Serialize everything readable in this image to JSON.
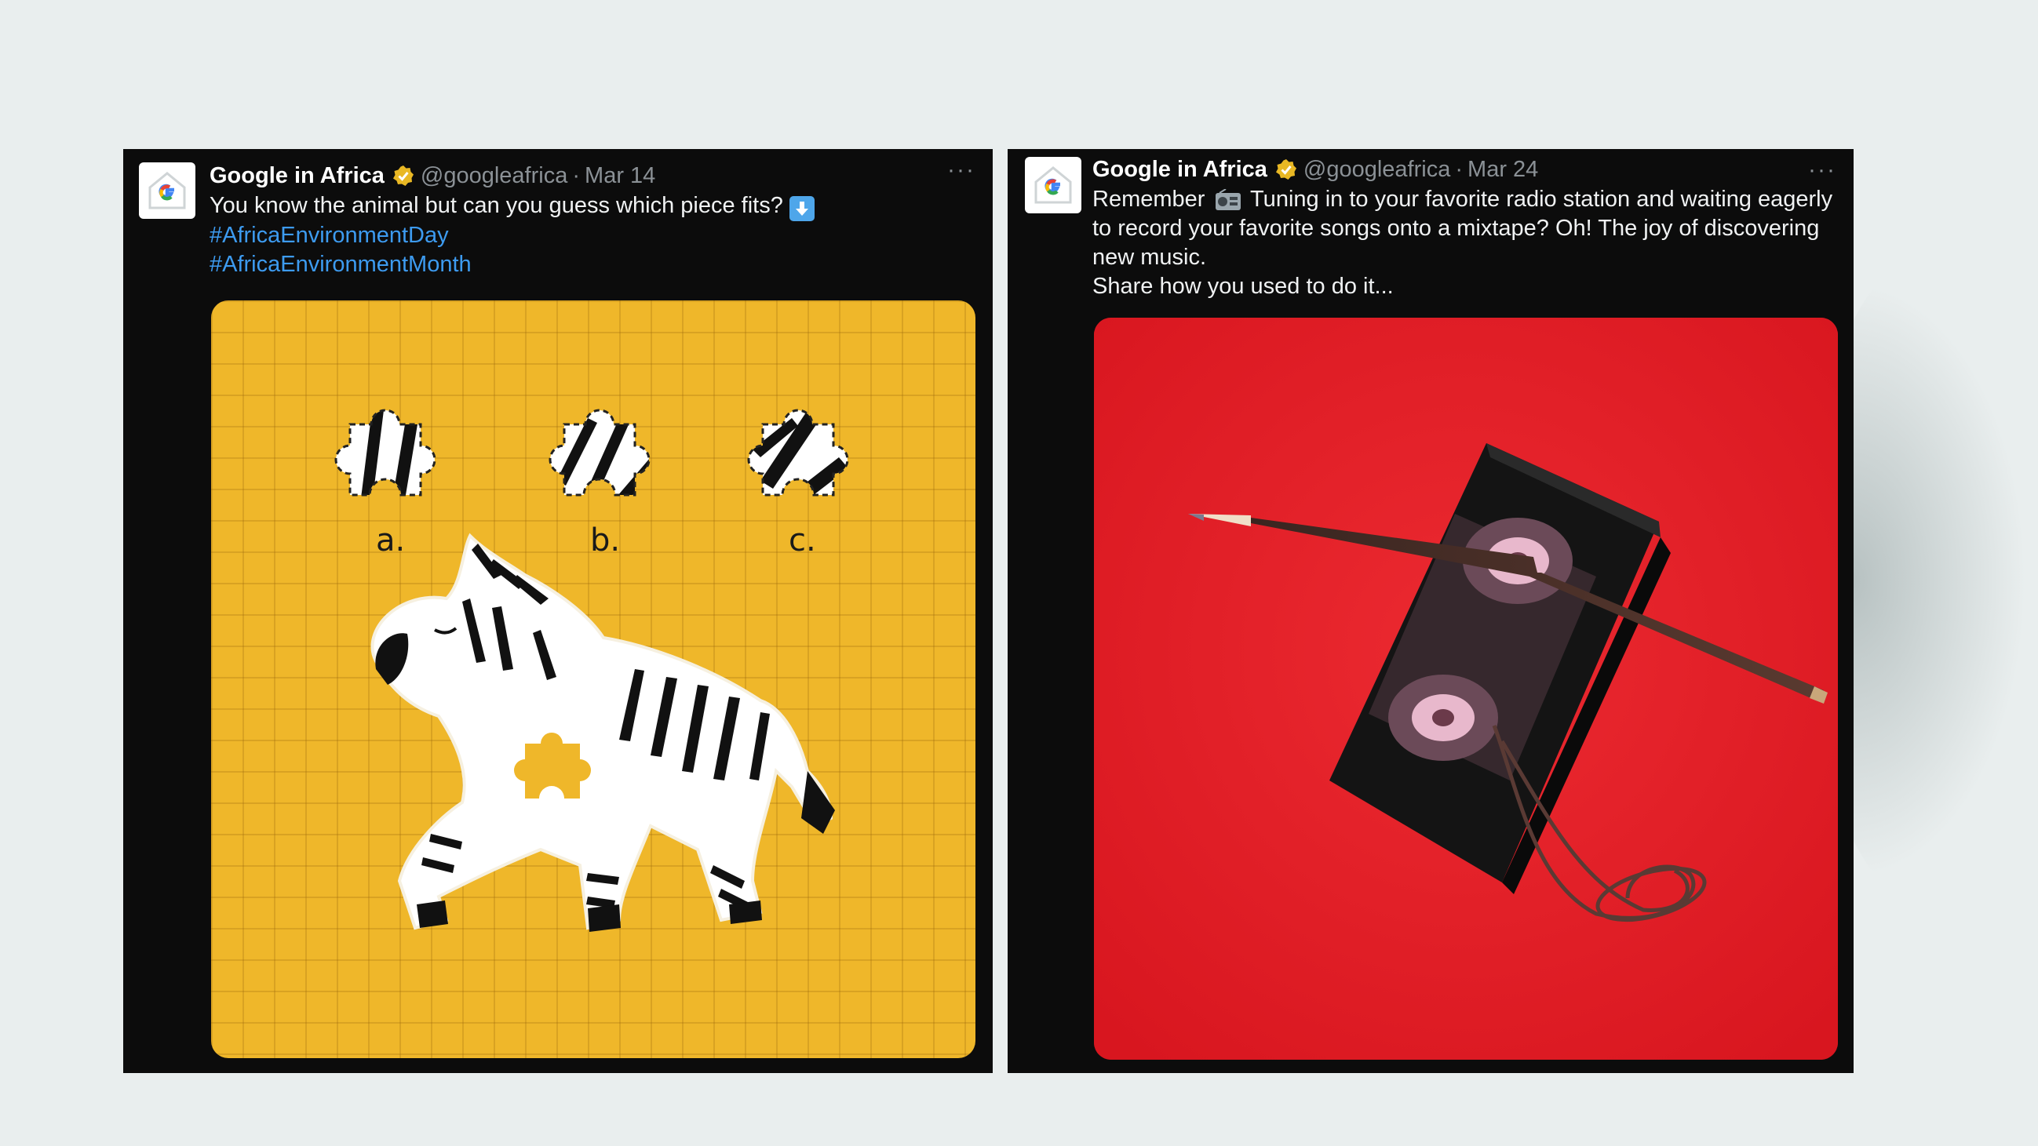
{
  "tweets": [
    {
      "author_name": "Google in Africa",
      "handle": "@googleafrica",
      "separator": "·",
      "date": "Mar 14",
      "more_label": "···",
      "text": "You know the animal but can you guess which piece fits?",
      "hashtags": [
        "#AfricaEnvironmentDay",
        "#AfricaEnvironmentMonth"
      ],
      "image": {
        "option_labels": [
          "a.",
          "b.",
          "c."
        ]
      }
    },
    {
      "author_name": "Google in Africa",
      "handle": "@googleafrica",
      "separator": "·",
      "date": "Mar 24",
      "more_label": "···",
      "text_before_emoji": "Remember",
      "text_after_emoji": "Tuning in to your favorite radio station and waiting eagerly to record your favorite songs onto a mixtape? Oh! The joy of discovering new music.",
      "text_line2": "Share how you used to do it..."
    }
  ],
  "icons": {
    "avatar": "google-g-logo",
    "verified": "verified-badge-gold",
    "emoji_tweet1": "down-arrow-emoji",
    "emoji_tweet2": "radio-emoji"
  },
  "colors": {
    "card_bg": "#0c0c0c",
    "hashtag": "#3d9bf0",
    "puzzle_bg": "#efb72a",
    "photo_bg": "#e51e27",
    "verified": "#e9b824"
  }
}
